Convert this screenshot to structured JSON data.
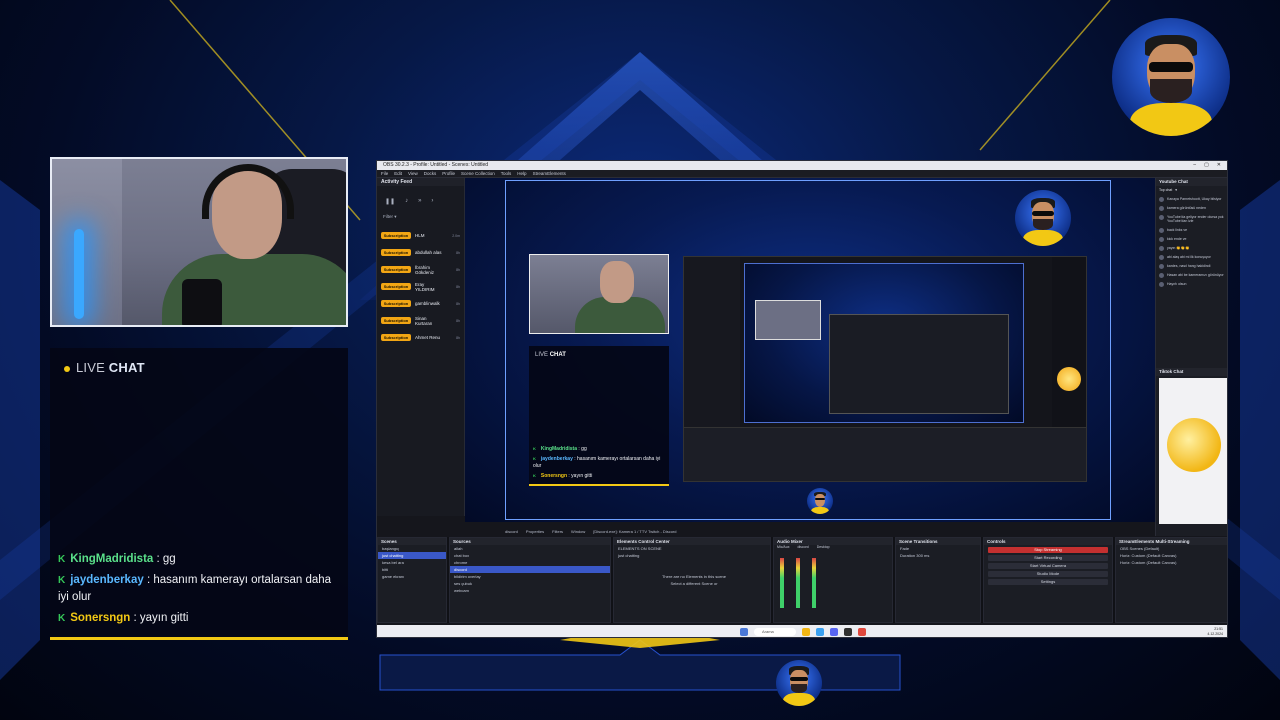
{
  "livechat": {
    "live_label": "LIVE",
    "chat_label": "CHAT",
    "messages": [
      {
        "user": "KingMadridista",
        "text": ": gg"
      },
      {
        "user": "jaydenberkay",
        "text": ": hasanım kamerayı ortalarsan daha iyi olur"
      },
      {
        "user": "Sonersngn",
        "text": ": yayın gitti"
      }
    ]
  },
  "obs": {
    "titlebar": "OBS 30.2.3 - Profile: Untitled - Scenes: Untitled",
    "menu": [
      "File",
      "Edit",
      "View",
      "Docks",
      "Profile",
      "Scene Collection",
      "Tools",
      "Help",
      "StreamElements"
    ],
    "activity_feed": {
      "title": "Activity Feed",
      "filter": "Filter",
      "badge": "Subscription",
      "items": [
        {
          "name": "HLM",
          "time": "2.0m"
        },
        {
          "name": "abdullah alas",
          "time": "8h"
        },
        {
          "name": "İbrahim Gökdeniz",
          "time": "8h"
        },
        {
          "name": "Eray YILDIRIM",
          "time": "8h"
        },
        {
          "name": "gamblinwalk",
          "time": "8h"
        },
        {
          "name": "Sinan Kurtaran",
          "time": "8h"
        },
        {
          "name": "Ahmet Renu",
          "time": "8h"
        }
      ]
    },
    "youtube_chat": {
      "title": "Youtube Chat",
      "mode": "Top chat",
      "rows": [
        "Kanaya Parnetshoott, Ukay bilsiyor",
        "kamera görüntüsü neden",
        "YouTube'da geliyor ender olursa yok YouTube'dan izle",
        "back links ve",
        "kick ende ve",
        "yayın 👏👏👏",
        "abi alaş abi mi ilk konuşuyor",
        "kardes, nasıl hang hakidindi",
        "Hasan abi be kameramızı görünüyor",
        "Hayırlı olsun"
      ]
    },
    "tiktok_chat": {
      "title": "Tiktok Chat"
    },
    "tabs": [
      "discord",
      "Properties",
      "Filters",
      "Window",
      "[Discord.exe]: Kamera 1 / TTV Twitch - Discord"
    ],
    "scenes": {
      "title": "Scenes",
      "items": [
        "başlangıç",
        "just chatting",
        "kesa bel ara",
        "bitti",
        "game ekranı"
      ],
      "selected": 1
    },
    "sources": {
      "title": "Sources",
      "items": [
        "allah",
        "chat box",
        "chrome",
        "discord",
        "bildirim overlay",
        "ses çubuk",
        "webcam"
      ],
      "selected": 3
    },
    "ecc": {
      "title": "Elements Control Center",
      "scene_label": "ELEMENTS ON SCENE",
      "scene_name": "just chatting",
      "empty": "There are no Elements in this scene",
      "select": "Select a different Scene or"
    },
    "mixer": {
      "title": "Audio Mixer",
      "channels": [
        "Mic/Aux",
        "discord",
        "Desktop"
      ]
    },
    "transitions": {
      "title": "Scene Transitions",
      "type": "Fade",
      "duration_label": "Duration",
      "duration": "300 ms"
    },
    "controls": {
      "title": "Controls",
      "buttons": [
        "Stop Streaming",
        "Start Recording",
        "Start Virtual Camera",
        "Studio Mode",
        "Settings"
      ]
    },
    "multistream": {
      "title": "StreamElements Multi-Streaming",
      "rows": [
        "OBS Scenes (Default)",
        "Horiz: Custom (Default Canvas)",
        "Horiz: Custom (Default Canvas)"
      ]
    },
    "status": "Dropped frames 0 (0.0%)   CPU: 8.7%   60.00 / 60.00 FPS",
    "taskbar": {
      "search": "Arama",
      "time": "21:51",
      "date": "4.12.2024"
    }
  }
}
